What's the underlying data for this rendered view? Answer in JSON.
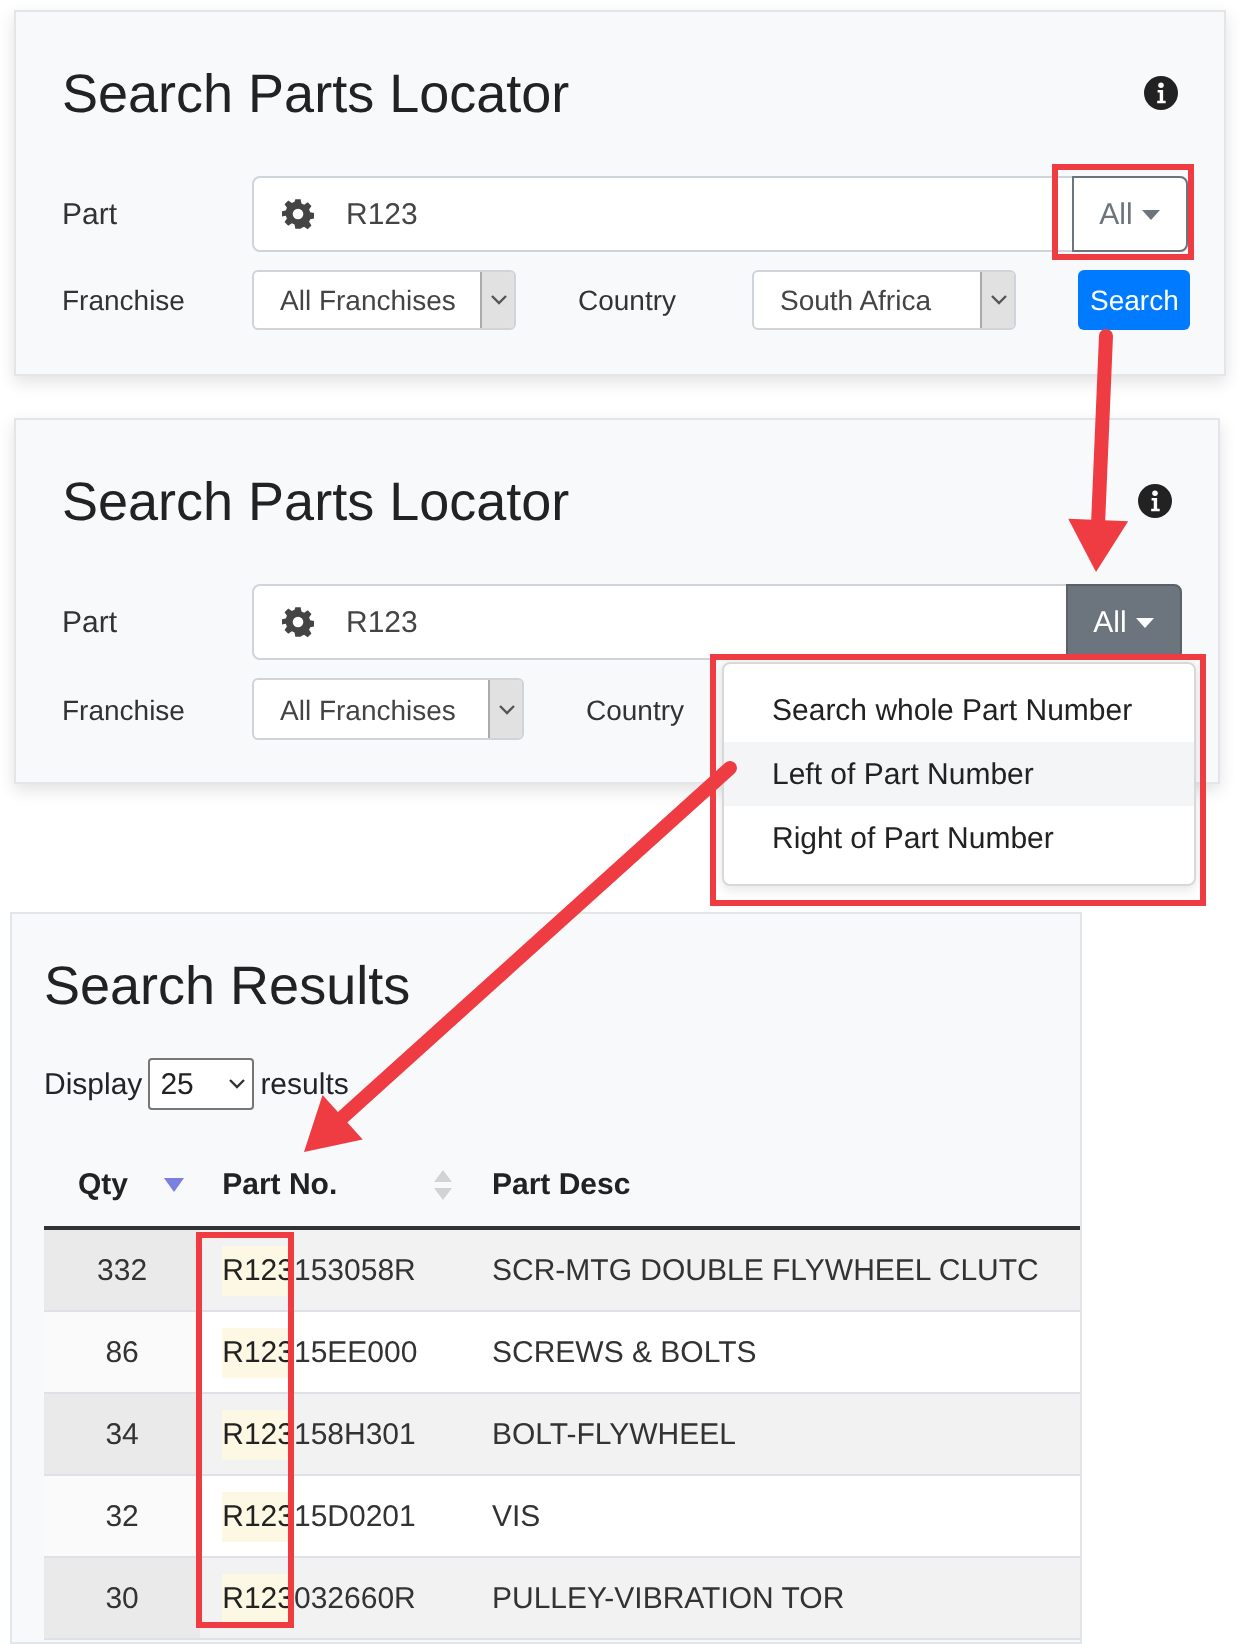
{
  "panels": [
    {
      "title": "Search Parts Locator",
      "part_label": "Part",
      "part_value": "R123",
      "mode_button": {
        "label": "All",
        "open": false
      },
      "franchise_label": "Franchise",
      "franchise_value": "All Franchises",
      "country_label": "Country",
      "country_value": "South Africa",
      "search_button": "Search"
    },
    {
      "title": "Search Parts Locator",
      "part_label": "Part",
      "part_value": "R123",
      "mode_button": {
        "label": "All",
        "open": true
      },
      "franchise_label": "Franchise",
      "franchise_value": "All Franchises",
      "country_label": "Country",
      "menu": [
        {
          "label": "Search whole Part Number",
          "highlighted": false
        },
        {
          "label": "Left of Part Number",
          "highlighted": true
        },
        {
          "label": "Right of Part Number",
          "highlighted": false
        }
      ]
    }
  ],
  "results": {
    "title": "Search Results",
    "display_label": "Display",
    "page_size": "25",
    "results_label": "results",
    "columns": [
      {
        "label": "Qty",
        "sorted": true
      },
      {
        "label": "Part No.",
        "sorted": false
      },
      {
        "label": "Part Desc"
      }
    ],
    "rows": [
      {
        "qty": "332",
        "match": "R123",
        "rest": "153058R",
        "desc": "SCR-MTG DOUBLE FLYWHEEL CLUTC"
      },
      {
        "qty": "86",
        "match": "R123",
        "rest": "15EE000",
        "desc": "SCREWS & BOLTS"
      },
      {
        "qty": "34",
        "match": "R123",
        "rest": "158H301",
        "desc": "BOLT-FLYWHEEL"
      },
      {
        "qty": "32",
        "match": "R123",
        "rest": "15D0201",
        "desc": "VIS"
      },
      {
        "qty": "30",
        "match": "R123",
        "rest": "032660R",
        "desc": "PULLEY-VIBRATION TOR"
      }
    ]
  }
}
